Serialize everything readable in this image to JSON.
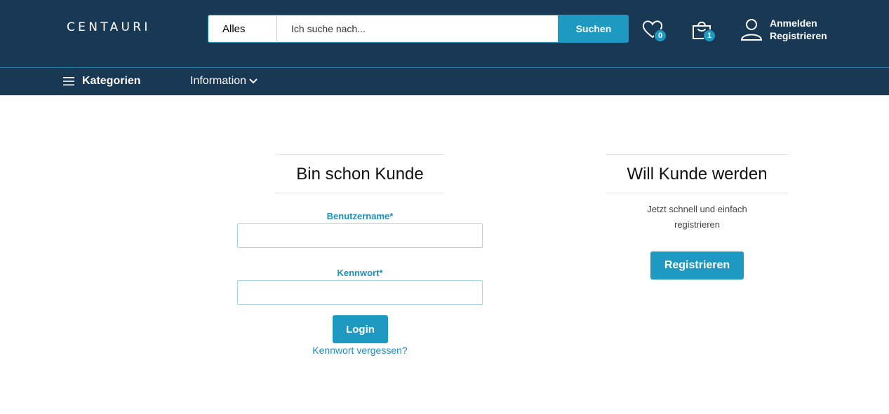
{
  "header": {
    "logo": "CENTAURI",
    "search": {
      "category": "Alles",
      "placeholder": "Ich suche nach...",
      "button": "Suchen"
    },
    "wishlist_count": "0",
    "cart_count": "1",
    "account": {
      "login": "Anmelden",
      "register": "Registrieren"
    }
  },
  "nav": {
    "categories": "Kategorien",
    "information": "Information"
  },
  "login": {
    "title": "Bin schon Kunde",
    "username_label": "Benutzername*",
    "password_label": "Kennwort*",
    "submit": "Login",
    "forgot": "Kennwort vergessen?"
  },
  "register": {
    "title": "Will Kunde werden",
    "line1": "Jetzt schnell und einfach",
    "line2": "registrieren",
    "button": "Registrieren"
  },
  "colors": {
    "header_bg": "#193853",
    "accent": "#1d99c2"
  }
}
